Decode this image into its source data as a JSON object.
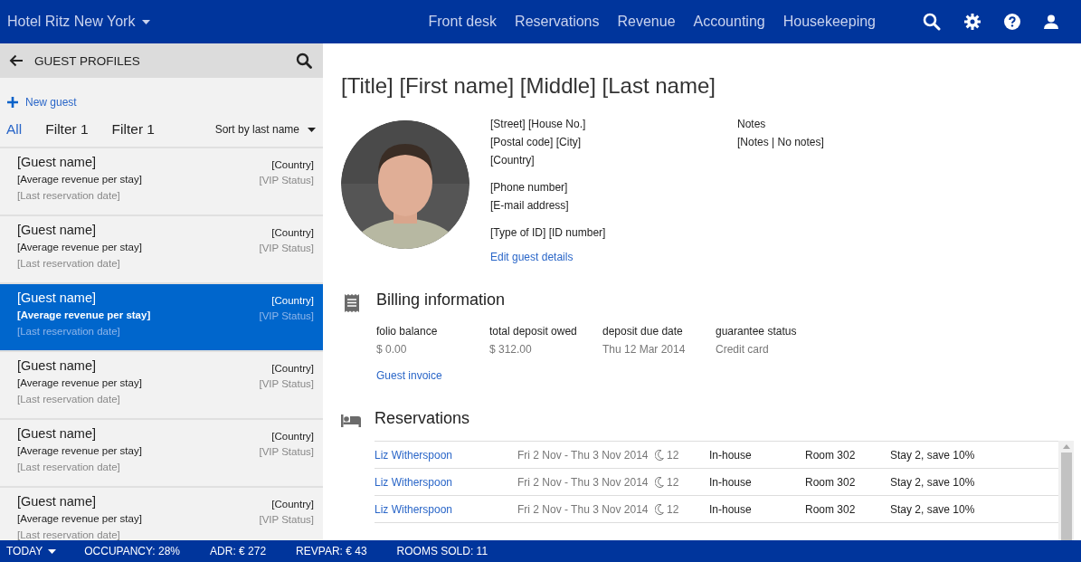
{
  "app_bar": {
    "hotel": "Hotel Ritz New York",
    "nav": [
      "Front desk",
      "Reservations",
      "Revenue",
      "Accounting",
      "Housekeeping"
    ]
  },
  "sidebar": {
    "title": "GUEST PROFILES",
    "new_guest": "New guest",
    "filters": [
      {
        "label": "All",
        "selected": true
      },
      {
        "label": "Filter 1",
        "selected": false
      },
      {
        "label": "Filter 1",
        "selected": false
      }
    ],
    "sort": "Sort by last name",
    "guests": [
      {
        "name": "[Guest name]",
        "country": "[Country]",
        "revenue": "[Average revenue per stay]",
        "vip": "[VIP Status]",
        "last_date": "[Last reservation date]",
        "selected": false
      },
      {
        "name": "[Guest name]",
        "country": "[Country]",
        "revenue": "[Average revenue per stay]",
        "vip": "[VIP Status]",
        "last_date": "[Last reservation date]",
        "selected": false
      },
      {
        "name": "[Guest name]",
        "country": "[Country]",
        "revenue": "[Average revenue per stay]",
        "vip": "[VIP Status]",
        "last_date": "[Last reservation date]",
        "selected": true
      },
      {
        "name": "[Guest name]",
        "country": "[Country]",
        "revenue": "[Average revenue per stay]",
        "vip": "[VIP Status]",
        "last_date": "[Last reservation date]",
        "selected": false
      },
      {
        "name": "[Guest name]",
        "country": "[Country]",
        "revenue": "[Average revenue per stay]",
        "vip": "[VIP Status]",
        "last_date": "[Last reservation date]",
        "selected": false
      },
      {
        "name": "[Guest name]",
        "country": "[Country]",
        "revenue": "[Average revenue per stay]",
        "vip": "[VIP Status]",
        "last_date": "[Last reservation date]",
        "selected": false
      }
    ]
  },
  "profile": {
    "full_name": "[Title] [First name] [Middle] [Last name]",
    "photo": {
      "kind": "picture"
    },
    "address_groups": [
      [
        "[Street] [House No.]",
        "[Postal code] [City]",
        "[Country]"
      ],
      [
        "[Phone number]",
        "[E-mail address]"
      ],
      [
        "[Type of ID] [ID number]"
      ]
    ],
    "edit_link": "Edit guest details",
    "notes_label": "Notes",
    "notes_value": "[Notes | No notes]"
  },
  "billing": {
    "heading": "Billing information",
    "fields": [
      {
        "label": "folio balance",
        "value": "$ 0.00"
      },
      {
        "label": "total deposit owed",
        "value": "$ 312.00"
      },
      {
        "label": "deposit due date",
        "value": "Thu 12 Mar 2014"
      },
      {
        "label": "guarantee status",
        "value": "Credit card"
      }
    ],
    "invoice_link": "Guest invoice"
  },
  "reservations": {
    "heading": "Reservations",
    "rows": [
      {
        "guest": "Liz Witherspoon",
        "dates": "Fri 2 Nov - Thu 3 Nov 2014",
        "nights": "12",
        "status": "In-house",
        "room": "Room 302",
        "offer": "Stay 2, save 10%"
      },
      {
        "guest": "Liz Witherspoon",
        "dates": "Fri 2 Nov - Thu 3 Nov 2014",
        "nights": "12",
        "status": "In-house",
        "room": "Room 302",
        "offer": "Stay 2, save 10%"
      },
      {
        "guest": "Liz Witherspoon",
        "dates": "Fri 2 Nov - Thu 3 Nov 2014",
        "nights": "12",
        "status": "In-house",
        "room": "Room 302",
        "offer": "Stay 2, save 10%"
      }
    ]
  },
  "status_bar": {
    "period": "TODAY",
    "stats": [
      "OCCUPANCY: 28%",
      "ADR: € 272",
      "REVPAR: € 43",
      "ROOMS SOLD: 11"
    ]
  }
}
